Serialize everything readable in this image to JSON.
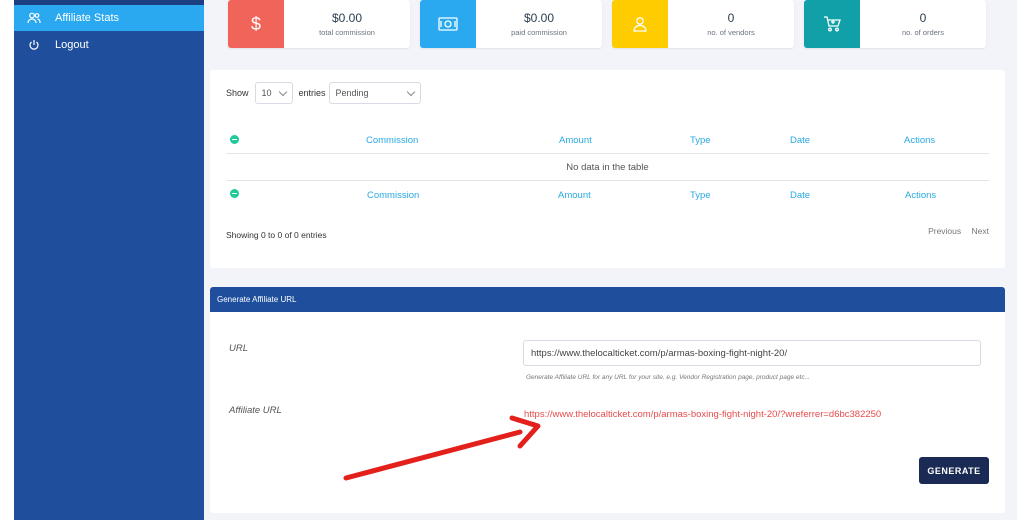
{
  "sidebar": {
    "items": [
      {
        "label": "Affiliate Stats",
        "icon": "users-icon",
        "active": true
      },
      {
        "label": "Logout",
        "icon": "power-icon",
        "active": false
      }
    ]
  },
  "stats": [
    {
      "value": "$0.00",
      "label": "total commission",
      "icon": "dollar-icon",
      "color": "#f0645a"
    },
    {
      "value": "$0.00",
      "label": "paid commission",
      "icon": "cash-icon",
      "color": "#2aa8f0"
    },
    {
      "value": "0",
      "label": "no. of vendors",
      "icon": "user-icon",
      "color": "#ffcc00"
    },
    {
      "value": "0",
      "label": "no. of orders",
      "icon": "cart-icon",
      "color": "#11a0a8"
    }
  ],
  "table": {
    "show_label": "Show",
    "entries_label": "entries",
    "page_size": "10",
    "status_filter": "Pending",
    "columns": [
      "Commission",
      "Amount",
      "Type",
      "Date",
      "Actions"
    ],
    "empty_text": "No data in the table",
    "info": "Showing 0 to 0 of 0 entries",
    "prev": "Previous",
    "next": "Next"
  },
  "generator": {
    "title": "Generate Affiliate URL",
    "url_label": "URL",
    "url_value": "https://www.thelocalticket.com/p/armas-boxing-fight-night-20/",
    "help_text": "Generate Affiliate URL for any URL for your site. e.g. Vendor Registration page, product page etc...",
    "affiliate_label": "Affiliate URL",
    "affiliate_value": "https://www.thelocalticket.com/p/armas-boxing-fight-night-20/?wreferrer=d6bc382250",
    "button": "GENERATE"
  },
  "colors": {
    "sidebar": "#1f4f9c",
    "active": "#2aa8f0",
    "link": "#29a9e1",
    "affiliate_url": "#e74c4c",
    "annotation_arrow": "#e3201b"
  }
}
